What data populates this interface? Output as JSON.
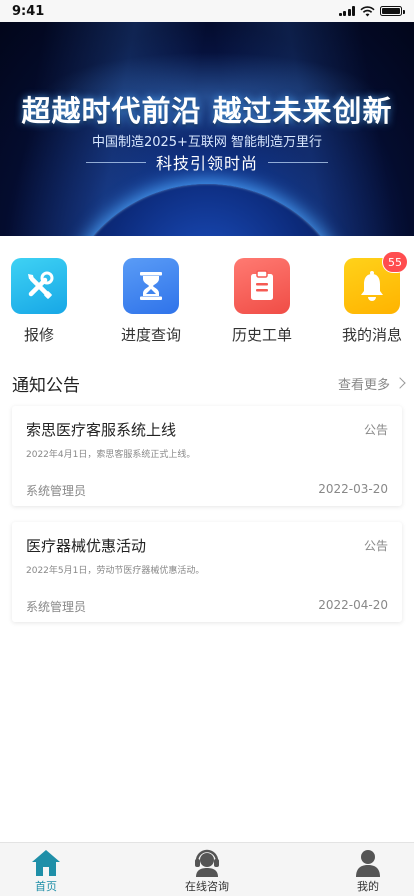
{
  "status_bar": {
    "time": "9:41"
  },
  "banner": {
    "headline": "超越时代前沿 越过未来创新",
    "subline": "中国制造2025+互联网 智能制造万里行",
    "tagline": "科技引领时尚"
  },
  "quick_actions": [
    {
      "label": "报修",
      "icon": "tools-icon",
      "color": "#23b9ee"
    },
    {
      "label": "进度查询",
      "icon": "hourglass-icon",
      "color": "#3f84ef"
    },
    {
      "label": "历史工单",
      "icon": "clipboard-icon",
      "color": "#f55a53"
    },
    {
      "label": "我的消息",
      "icon": "bell-icon",
      "color": "#ffbf00",
      "badge": "55"
    }
  ],
  "notices_section": {
    "title": "通知公告",
    "more": "查看更多"
  },
  "notices": [
    {
      "title": "索思医疗客服系统上线",
      "tag": "公告",
      "desc": "2022年4月1日，索思客服系统正式上线。",
      "author": "系统管理员",
      "date": "2022-03-20"
    },
    {
      "title": "医疗器械优惠活动",
      "tag": "公告",
      "desc": "2022年5月1日，劳动节医疗器械优惠活动。",
      "author": "系统管理员",
      "date": "2022-04-20"
    }
  ],
  "tab_bar": {
    "active": "首页",
    "items": [
      {
        "label": "首页",
        "icon": "home-icon"
      },
      {
        "label": "在线咨询",
        "icon": "headset-icon"
      },
      {
        "label": "我的",
        "icon": "user-icon"
      }
    ]
  },
  "colors": {
    "accent": "#1f8fa8",
    "badge": "#ff4d4f"
  }
}
